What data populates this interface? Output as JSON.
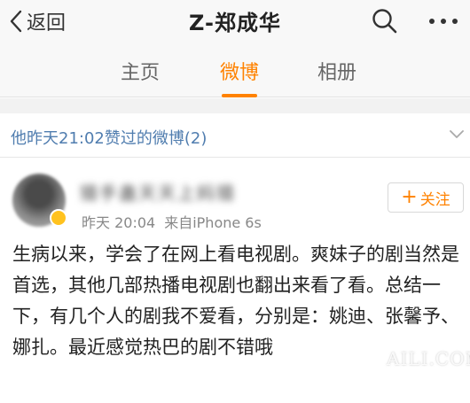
{
  "header": {
    "back_label": "返回",
    "title": "Z-郑成华",
    "search_icon": "search-icon",
    "more_icon": "more-dots-icon"
  },
  "tabs": [
    {
      "label": "主页",
      "active": false
    },
    {
      "label": "微博",
      "active": true
    },
    {
      "label": "相册",
      "active": false
    }
  ],
  "liked_bar": {
    "text": "他昨天21:02赞过的微博(2)"
  },
  "post": {
    "username": "猎手蛊天天上妈猎",
    "time": "昨天 20:04",
    "source": "来自iPhone 6s",
    "follow_label": "关注",
    "text": "生病以来，学会了在网上看电视剧。爽妹子的剧当然是首选，其他几部热播电视剧也翻出来看了看。总结一下，有几个人的剧我不爱看，分别是：姚迪、张馨予、娜扎。最近感觉热巴的剧不错哦"
  },
  "watermark": "AILI.COM",
  "colors": {
    "accent": "#ff8200",
    "link": "#507daf",
    "badge": "#ffc21e"
  }
}
